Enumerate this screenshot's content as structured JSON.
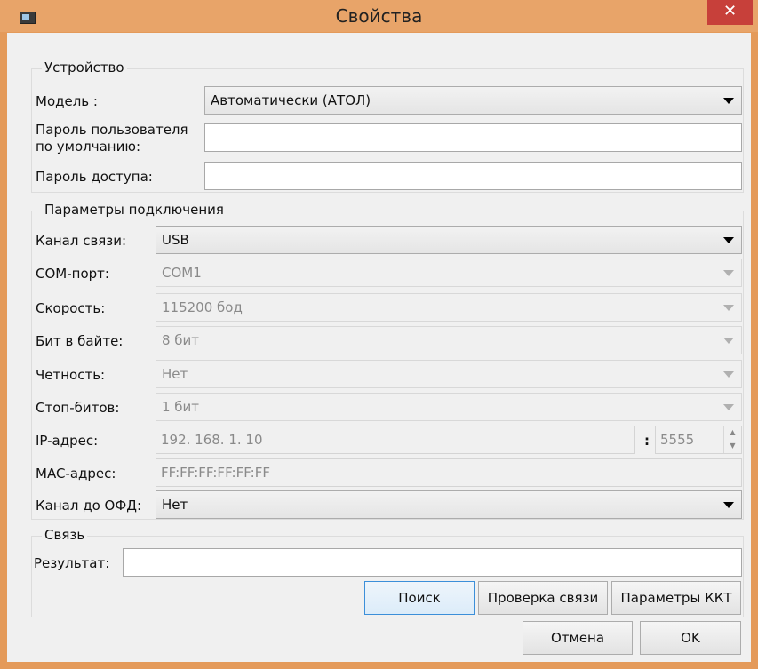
{
  "window": {
    "title": "Свойства",
    "close_glyph": "✕"
  },
  "device": {
    "legend": "Устройство",
    "model_label": "Модель :",
    "model_value": "Автоматически (АТОЛ)",
    "user_password_label_1": "Пароль пользователя",
    "user_password_label_2": "по умолчанию:",
    "user_password_value": "",
    "access_password_label": "Пароль доступа:",
    "access_password_value": ""
  },
  "connection": {
    "legend": "Параметры подключения",
    "channel_label": "Канал связи:",
    "channel_value": "USB",
    "com_label": "COM-порт:",
    "com_value": "COM1",
    "speed_label": "Скорость:",
    "speed_value": "115200 бод",
    "bits_label": "Бит в байте:",
    "bits_value": "8 бит",
    "parity_label": "Четность:",
    "parity_value": "Нет",
    "stop_label": "Стоп-битов:",
    "stop_value": "1 бит",
    "ip_label": "IP-адрес:",
    "ip_value": "192. 168. 1. 10",
    "port_separator": ":",
    "port_value": "5555",
    "mac_label": "MAC-адрес:",
    "mac_value": "FF:FF:FF:FF:FF:FF",
    "ofd_label": "Канал до ОФД:",
    "ofd_value": "Нет"
  },
  "link": {
    "legend": "Связь",
    "result_label": "Результат:",
    "result_value": "",
    "search_button": "Поиск",
    "check_button": "Проверка связи",
    "kkt_button": "Параметры ККТ"
  },
  "footer": {
    "cancel_button": "Отмена",
    "ok_button": "OK"
  },
  "colors": {
    "titlebar": "#e8a469",
    "close": "#c7403a",
    "focus": "#3c8fd9"
  }
}
